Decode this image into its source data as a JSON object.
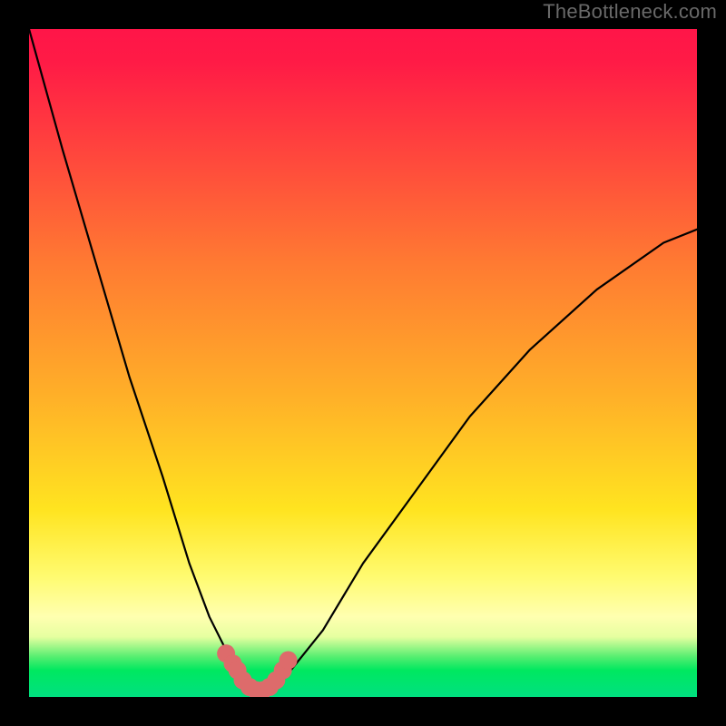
{
  "watermark": "TheBottleneck.com",
  "chart_data": {
    "type": "line",
    "title": "",
    "xlabel": "",
    "ylabel": "",
    "xlim": [
      0,
      100
    ],
    "ylim": [
      0,
      100
    ],
    "grid": false,
    "legend": "none",
    "series": [
      {
        "name": "bottleneck-curve",
        "x": [
          0,
          5,
          10,
          15,
          20,
          24,
          27,
          30,
          31,
          32,
          33,
          34,
          35,
          36,
          37,
          38,
          40,
          44,
          50,
          58,
          66,
          75,
          85,
          95,
          100
        ],
        "y": [
          100,
          82,
          65,
          48,
          33,
          20,
          12,
          6,
          4,
          2.5,
          1.5,
          1,
          1,
          1,
          1.5,
          2.5,
          5,
          10,
          20,
          31,
          42,
          52,
          61,
          68,
          70
        ]
      }
    ],
    "annotations": {
      "near_minimum_markers": {
        "color": "#dd6b6b",
        "radius_approx": 2,
        "x": [
          29.5,
          30.5,
          31.2,
          32,
          33,
          34,
          35,
          36,
          37,
          38,
          38.8
        ],
        "y": [
          6.5,
          5,
          4,
          2.5,
          1.5,
          1,
          1,
          1.5,
          2.5,
          4,
          5.5
        ]
      }
    },
    "background": {
      "style": "vertical-gradient",
      "stops": [
        {
          "pos": 0.0,
          "color": "#ff1548"
        },
        {
          "pos": 0.35,
          "color": "#ff7a32"
        },
        {
          "pos": 0.72,
          "color": "#ffe420"
        },
        {
          "pos": 0.9,
          "color": "#ffffb0"
        },
        {
          "pos": 0.96,
          "color": "#00e860"
        },
        {
          "pos": 1.0,
          "color": "#00e080"
        }
      ]
    }
  }
}
